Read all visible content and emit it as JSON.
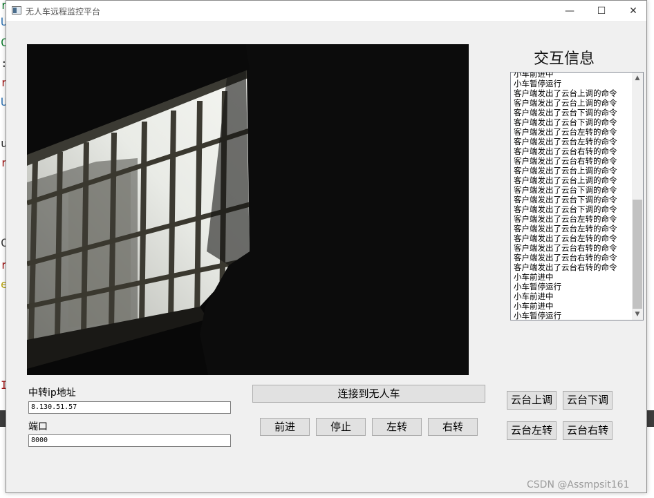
{
  "window": {
    "title": "无人车远程监控平台"
  },
  "window_controls": {
    "minimize": "—",
    "maximize": "☐",
    "close": "✕"
  },
  "panel": {
    "title": "交互信息"
  },
  "log_lines": [
    "小车前进中",
    "小车暂停运行",
    "客户端发出了云台上调的命令",
    "客户端发出了云台上调的命令",
    "客户端发出了云台下调的命令",
    "客户端发出了云台下调的命令",
    "客户端发出了云台左转的命令",
    "客户端发出了云台左转的命令",
    "客户端发出了云台右转的命令",
    "客户端发出了云台右转的命令",
    "客户端发出了云台上调的命令",
    "客户端发出了云台上调的命令",
    "客户端发出了云台下调的命令",
    "客户端发出了云台下调的命令",
    "客户端发出了云台下调的命令",
    "客户端发出了云台左转的命令",
    "客户端发出了云台左转的命令",
    "客户端发出了云台左转的命令",
    "客户端发出了云台右转的命令",
    "客户端发出了云台右转的命令",
    "客户端发出了云台右转的命令",
    "小车前进中",
    "小车暂停运行",
    "小车前进中",
    "小车前进中",
    "小车暂停运行"
  ],
  "relay": {
    "ip_label": "中转ip地址",
    "ip_value": "8.130.51.57",
    "port_label": "端口",
    "port_value": "8000"
  },
  "connect": {
    "label": "连接到无人车"
  },
  "motion": {
    "forward": "前进",
    "stop": "停止",
    "left": "左转",
    "right": "右转"
  },
  "gimbal": {
    "up": "云台上调",
    "down": "云台下调",
    "left": "云台左转",
    "right": "云台右转"
  },
  "watermark": "CSDN @Assmpsit161",
  "background_editor_chars": [
    "r",
    "U",
    "C",
    ":",
    "r",
    "U",
    "u",
    "r",
    "C",
    "r",
    "e",
    "I"
  ]
}
